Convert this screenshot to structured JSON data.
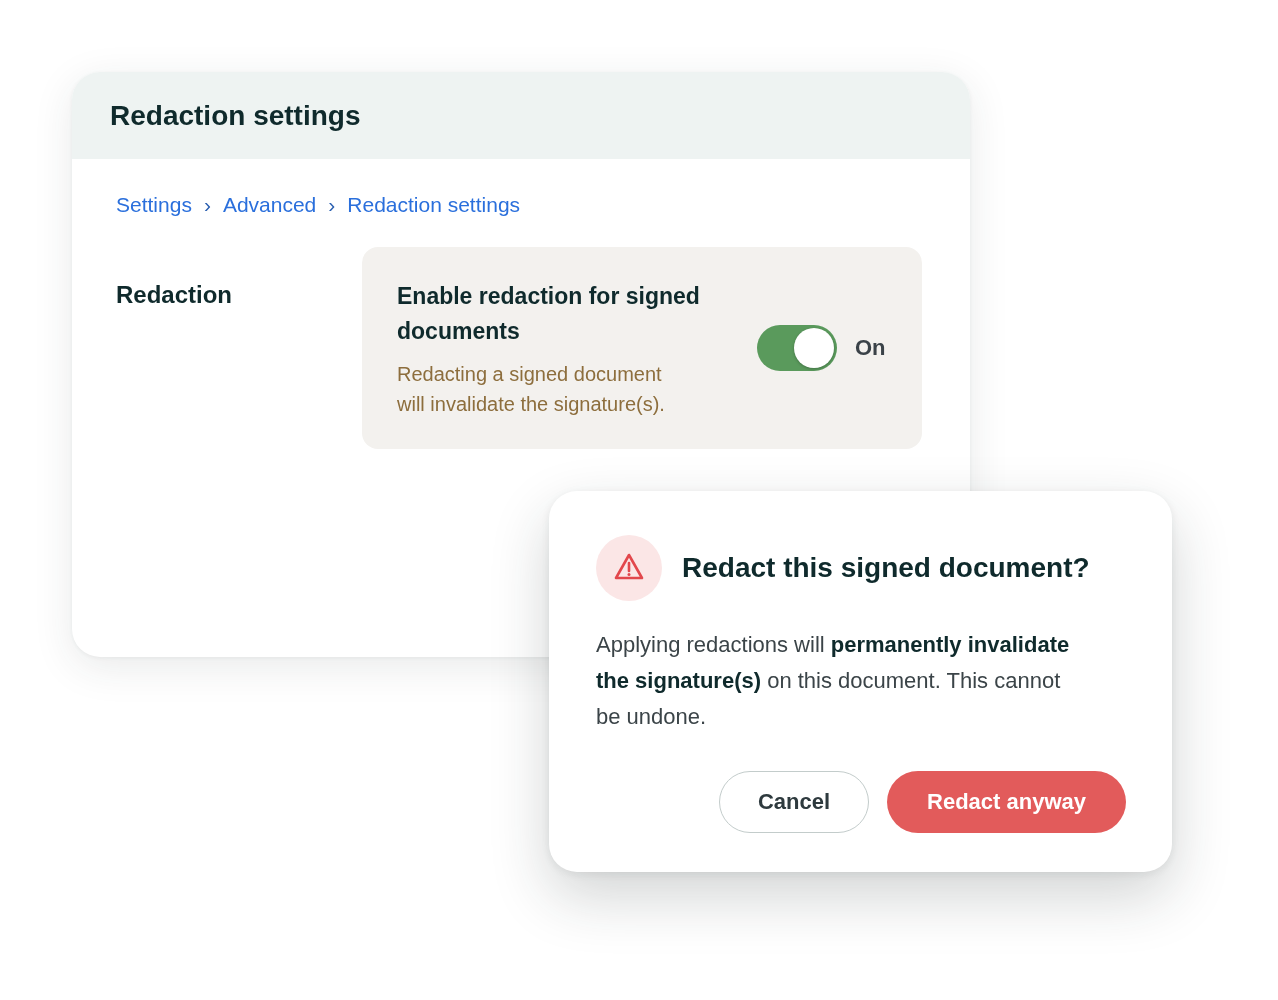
{
  "settings_card": {
    "title": "Redaction settings",
    "breadcrumb": [
      {
        "kind": "link",
        "text": "Settings"
      },
      {
        "kind": "separator",
        "text": "›"
      },
      {
        "kind": "link",
        "text": "Advanced"
      },
      {
        "kind": "separator",
        "text": "›"
      },
      {
        "kind": "link",
        "text": "Redaction settings"
      }
    ],
    "section_label": "Redaction",
    "setting": {
      "title": "Enable redaction for signed documents",
      "description": "Redacting a signed document will invalidate the signature(s).",
      "on": true,
      "state_label": "On"
    }
  },
  "dialog": {
    "title": "Redact this signed document?",
    "body": "Applying redactions will **permanently invalidate the signature(s)** on this document. This cannot be undone.",
    "buttons": [
      {
        "kind": "secondary",
        "label": "Cancel"
      },
      {
        "kind": "primary",
        "label": "Redact anyway"
      }
    ]
  }
}
